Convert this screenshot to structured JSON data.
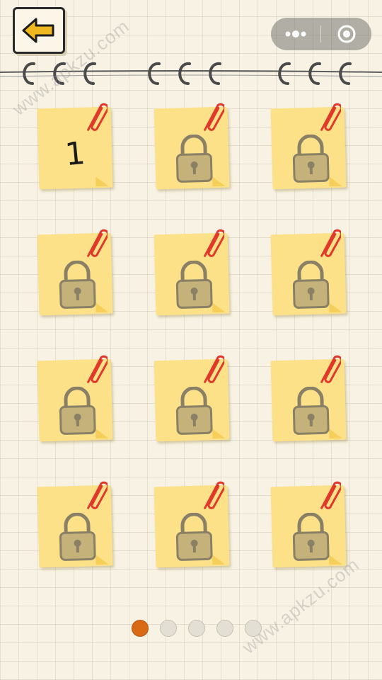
{
  "header": {
    "back_icon": "arrow-left-icon",
    "capsule": {
      "more_icon": "more-dots-icon",
      "close_icon": "target-circle-icon"
    }
  },
  "levels": [
    {
      "label": "1",
      "locked": false
    },
    {
      "label": "",
      "locked": true
    },
    {
      "label": "",
      "locked": true
    },
    {
      "label": "",
      "locked": true
    },
    {
      "label": "",
      "locked": true
    },
    {
      "label": "",
      "locked": true
    },
    {
      "label": "",
      "locked": true
    },
    {
      "label": "",
      "locked": true
    },
    {
      "label": "",
      "locked": true
    },
    {
      "label": "",
      "locked": true
    },
    {
      "label": "",
      "locked": true
    },
    {
      "label": "",
      "locked": true
    }
  ],
  "pagination": {
    "total": 5,
    "current": 1
  },
  "watermark": {
    "top": "www.apkzu.com",
    "bottom": "www.apkzu.com"
  },
  "colors": {
    "note": "#fce188",
    "accent": "#d86a15",
    "lock": "#c4b27a",
    "clip": "#e0392b"
  }
}
